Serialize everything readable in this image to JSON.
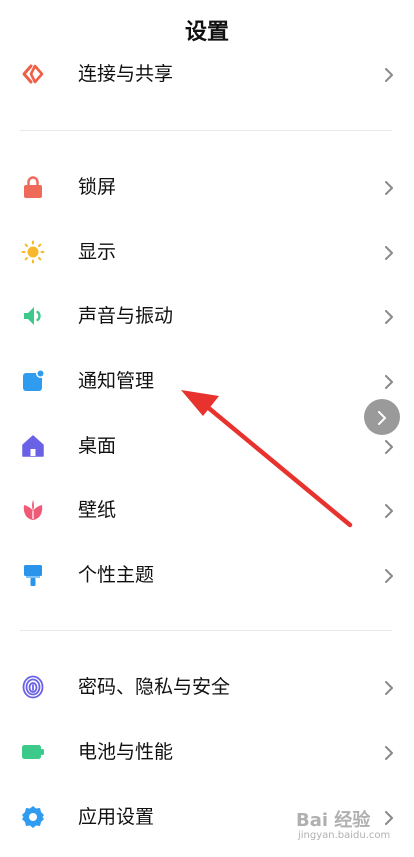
{
  "header": {
    "title": "设置"
  },
  "items": [
    {
      "label": "连接与共享",
      "icon": "share-icon",
      "color": "#ee5f45"
    },
    {
      "label": "锁屏",
      "icon": "lock-icon",
      "color": "#f06a5a"
    },
    {
      "label": "显示",
      "icon": "sun-icon",
      "color": "#f8b82c"
    },
    {
      "label": "声音与振动",
      "icon": "speaker-icon",
      "color": "#3cc98a"
    },
    {
      "label": "通知管理",
      "icon": "notification-icon",
      "color": "#2f9cf0"
    },
    {
      "label": "桌面",
      "icon": "home-icon",
      "color": "#6a62e6"
    },
    {
      "label": "壁纸",
      "icon": "flower-icon",
      "color": "#ef5b76"
    },
    {
      "label": "个性主题",
      "icon": "brush-icon",
      "color": "#2a93ea"
    },
    {
      "label": "密码、隐私与安全",
      "icon": "fingerprint-icon",
      "color": "#6a62e6"
    },
    {
      "label": "电池与性能",
      "icon": "battery-icon",
      "color": "#3cc98a"
    },
    {
      "label": "应用设置",
      "icon": "gear-icon",
      "color": "#2f9cf0"
    }
  ],
  "watermark": {
    "brand": "Bai 经验",
    "site": "jingyan.baidu.com"
  },
  "colors": {
    "annotation_arrow": "#e8322e",
    "floating_button": "#9a9a9a"
  }
}
